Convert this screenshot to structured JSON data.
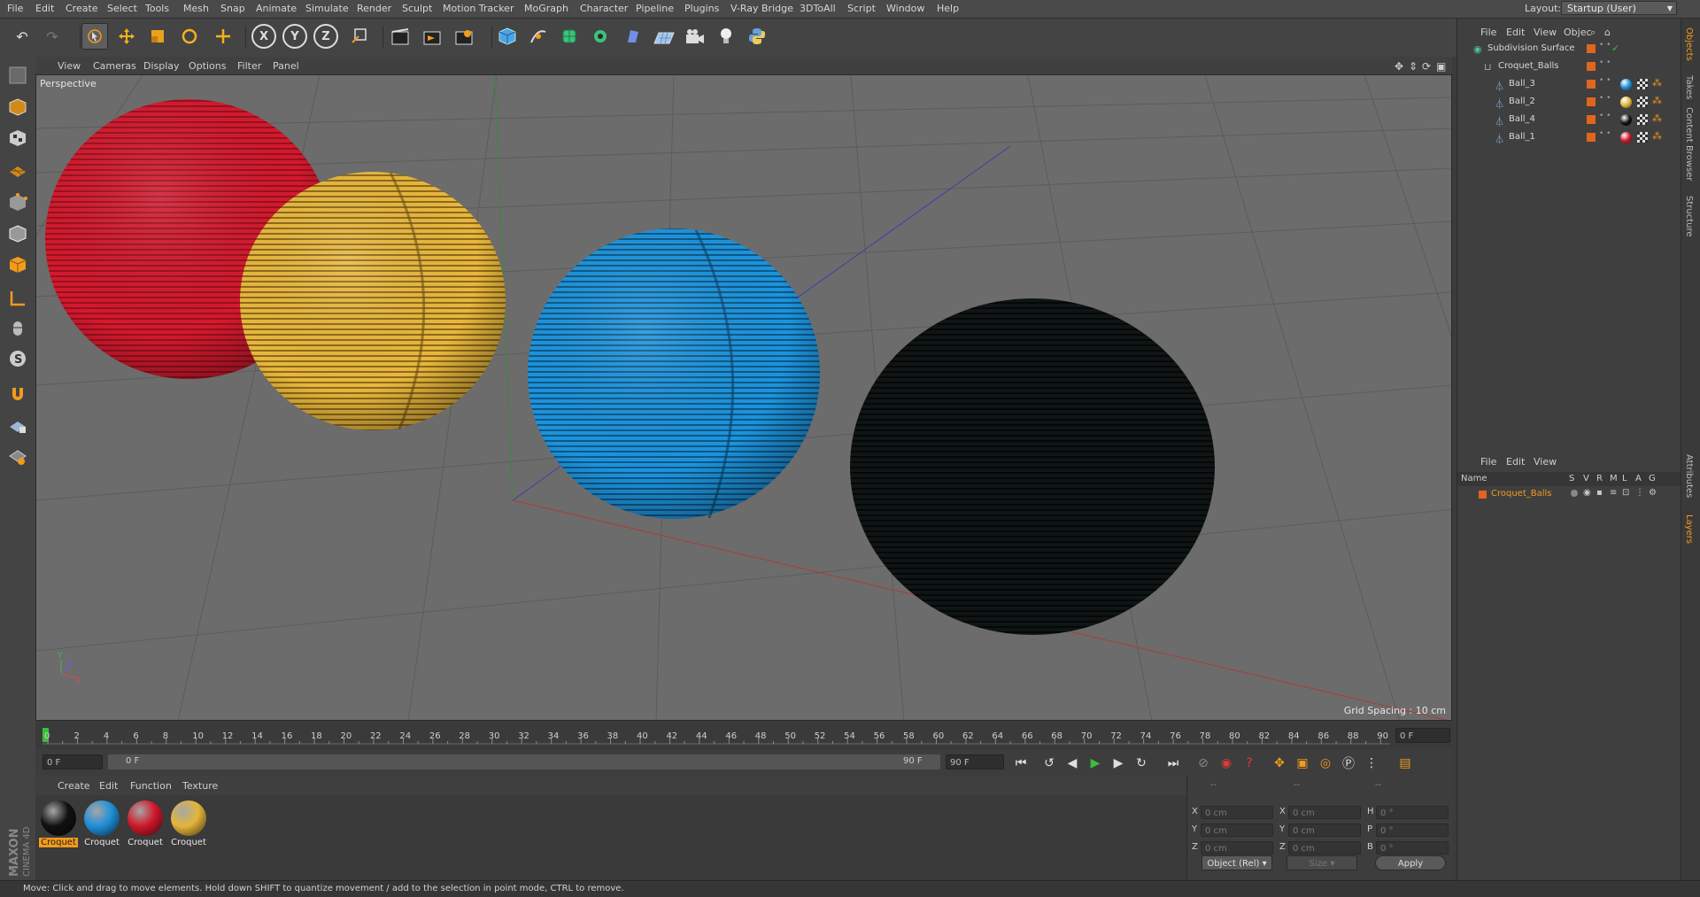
{
  "menu": [
    "File",
    "Edit",
    "Create",
    "Select",
    "Tools",
    "Mesh",
    "Snap",
    "Animate",
    "Simulate",
    "Render",
    "Sculpt",
    "Motion Tracker",
    "MoGraph",
    "Character",
    "Pipeline",
    "Plugins",
    "V-Ray Bridge",
    "3DToAll",
    "Script",
    "Window",
    "Help"
  ],
  "layout": {
    "label": "Layout:",
    "value": "Startup (User)"
  },
  "toolbar": {
    "icons": [
      "undo-icon",
      "redo-icon",
      "live-selection-icon",
      "move-icon",
      "scale-icon",
      "rotate-icon",
      "last-tool-icon",
      "x-axis-icon",
      "y-axis-icon",
      "z-axis-icon",
      "world-coordinates-icon",
      "render-view-icon",
      "render-picture-viewer-icon",
      "edit-render-settings-icon",
      "cube-icon",
      "pen-spline-icon",
      "subdivision-surface-icon",
      "cloner-icon",
      "deformer-icon",
      "floor-icon",
      "camera-icon",
      "light-icon",
      "python-icon"
    ],
    "axis_x": "X",
    "axis_y": "Y",
    "axis_z": "Z"
  },
  "viewport": {
    "menu": [
      "View",
      "Cameras",
      "Display",
      "Options",
      "Filter",
      "Panel"
    ],
    "camera": "Perspective",
    "grid_spacing": "Grid Spacing : 10 cm",
    "axis_y": "Y",
    "axis_z": "Z",
    "axis_x": "X"
  },
  "timeline": {
    "ticks": [
      "0",
      "2",
      "4",
      "6",
      "8",
      "10",
      "12",
      "14",
      "16",
      "18",
      "20",
      "22",
      "24",
      "26",
      "28",
      "30",
      "32",
      "34",
      "36",
      "38",
      "40",
      "42",
      "44",
      "46",
      "48",
      "50",
      "52",
      "54",
      "56",
      "58",
      "60",
      "62",
      "64",
      "66",
      "68",
      "70",
      "72",
      "74",
      "76",
      "78",
      "80",
      "82",
      "84",
      "86",
      "88",
      "90"
    ],
    "current_frame": "0 F"
  },
  "transport": {
    "start": "0 F",
    "range_start": "0 F",
    "range_end": "90 F",
    "end": "90 F"
  },
  "materials": {
    "menu": [
      "Create",
      "Edit",
      "Function",
      "Texture"
    ],
    "items": [
      {
        "label": "Croquet",
        "color": "#111111",
        "selected": true
      },
      {
        "label": "Croquet",
        "color": "#1f8fd8",
        "selected": false
      },
      {
        "label": "Croquet",
        "color": "#d0182a",
        "selected": false
      },
      {
        "label": "Croquet",
        "color": "#e4b53a",
        "selected": false
      }
    ]
  },
  "coords": {
    "header": [
      "--",
      "--",
      "--"
    ],
    "rows": [
      {
        "a": "X",
        "av": "0 cm",
        "b": "X",
        "bv": "0 cm",
        "c": "H",
        "cv": "0 °"
      },
      {
        "a": "Y",
        "av": "0 cm",
        "b": "Y",
        "bv": "0 cm",
        "c": "P",
        "cv": "0 °"
      },
      {
        "a": "Z",
        "av": "0 cm",
        "b": "Z",
        "bv": "0 cm",
        "c": "B",
        "cv": "0 °"
      }
    ],
    "mode": "Object (Rel)",
    "size": "Size",
    "apply": "Apply"
  },
  "objects": {
    "menu": [
      "File",
      "Edit",
      "View",
      "Objec"
    ],
    "tree": [
      {
        "name": "Subdivision Surface",
        "indent": 0,
        "color": "#4fc1a3"
      },
      {
        "name": "Croquet_Balls",
        "indent": 1,
        "color": "#aaaaaa"
      },
      {
        "name": "Ball_3",
        "indent": 2,
        "color": "#8fb0d8",
        "mat": "#1f8fd8"
      },
      {
        "name": "Ball_2",
        "indent": 2,
        "color": "#8fb0d8",
        "mat": "#e4b53a"
      },
      {
        "name": "Ball_4",
        "indent": 2,
        "color": "#8fb0d8",
        "mat": "#111111"
      },
      {
        "name": "Ball_1",
        "indent": 2,
        "color": "#8fb0d8",
        "mat": "#d0182a"
      }
    ]
  },
  "layers": {
    "menu": [
      "File",
      "Edit",
      "View"
    ],
    "columns": [
      "Name",
      "S",
      "V",
      "R",
      "M",
      "L",
      "A",
      "G"
    ],
    "row": "Croquet_Balls"
  },
  "right_tabs": [
    "Objects",
    "Takes",
    "Content Browser",
    "Structure",
    "Attributes",
    "Layers"
  ],
  "status": "Move: Click and drag to move elements. Hold down SHIFT to quantize movement / add to the selection in point mode, CTRL to remove.",
  "brand": "MAXON CINEMA 4D"
}
